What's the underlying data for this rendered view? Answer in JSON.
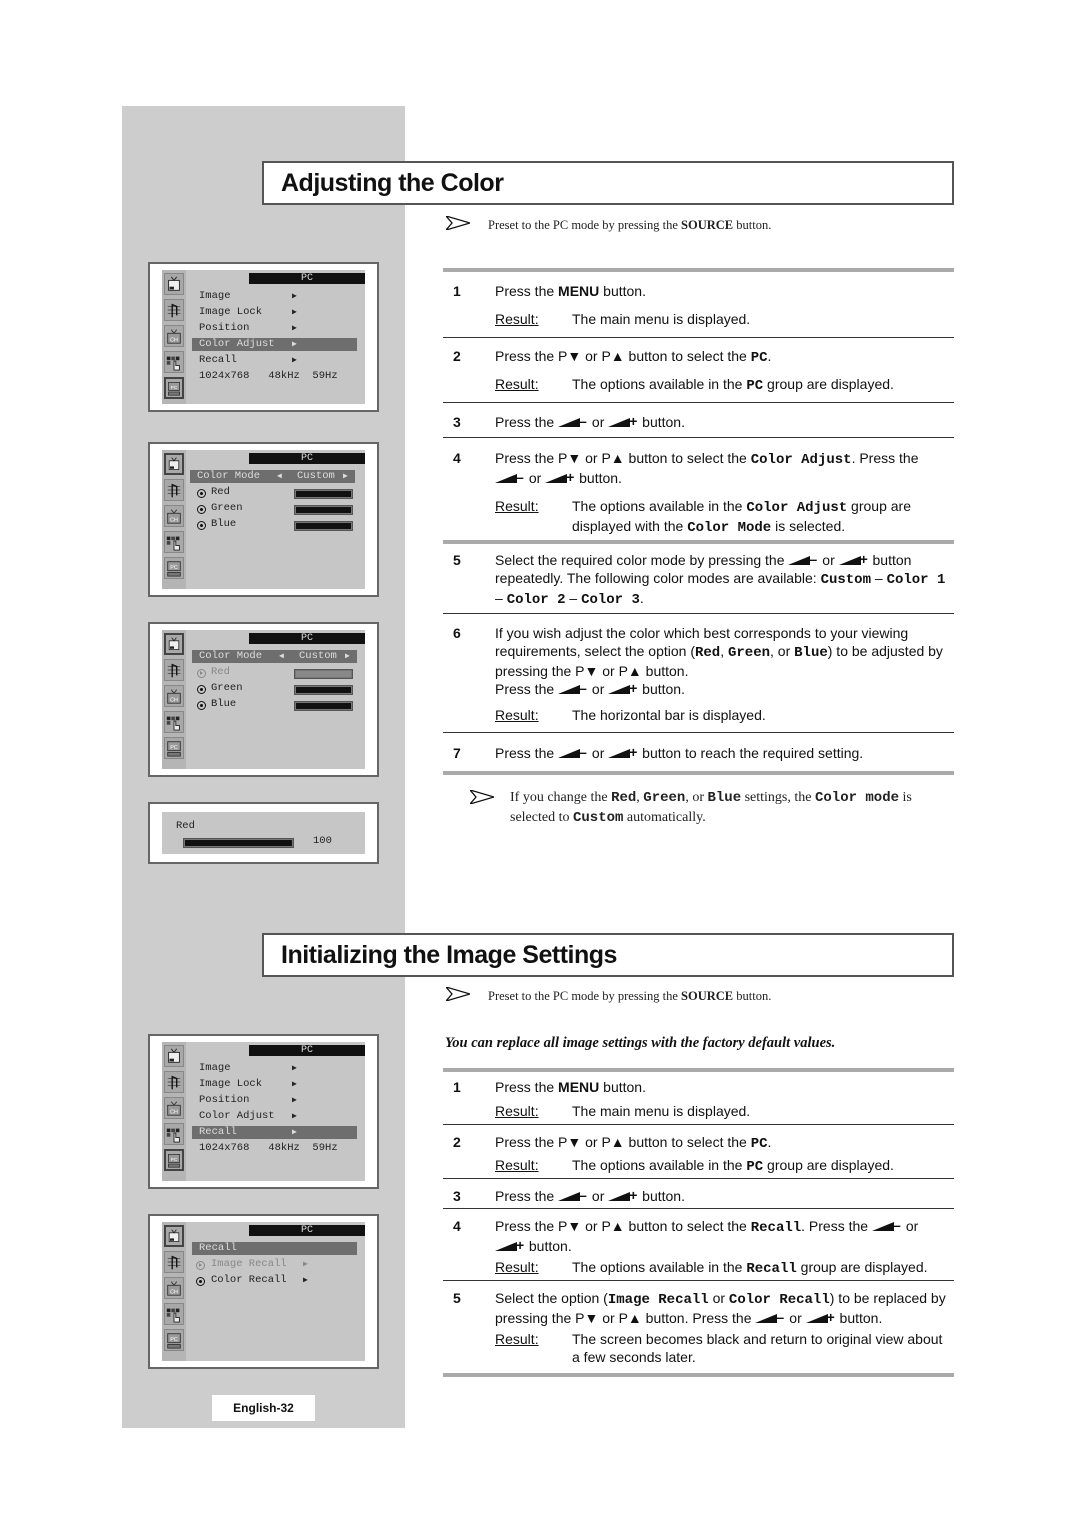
{
  "page": {
    "number_label": "English-32"
  },
  "section1": {
    "title": "Adjusting the Color",
    "note": {
      "prefix": "Preset to the PC mode by pressing the ",
      "bold": "SOURCE",
      "suffix": " button."
    },
    "steps": [
      {
        "num": "1",
        "text": "Press the <b>MENU</b> button.",
        "result_label": "Result",
        "result": "The main menu is displayed."
      },
      {
        "num": "2",
        "text": "Press the P▼ or P▲ button to select the <span class='mono'>PC</span>.",
        "result_label": "Result",
        "result": "The options available in the <span class='mono'>PC</span> group are displayed."
      },
      {
        "num": "3",
        "text": "Press the {vol-} or {vol+} button."
      },
      {
        "num": "4",
        "text": "Press the P▼ or P▲ button to select the <span class='mono'>Color Adjust</span>. Press the {vol-} or {vol+} button.",
        "result_label": "Result",
        "result": "The options available in the <span class='mono'>Color Adjust</span> group are displayed with the <span class='mono'>Color Mode</span> is selected."
      },
      {
        "num": "5",
        "text": "Select the required color mode by pressing the {vol-} or {vol+} button repeatedly. The following color modes are available: <span class='mono'>Custom</span> – <span class='mono'>Color 1</span> – <span class='mono'>Color 2</span> – <span class='mono'>Color 3</span>."
      },
      {
        "num": "6",
        "text": "If you wish adjust the color which best corresponds to your viewing requirements, select the option (<span class='mono'>Red</span>, <span class='mono'>Green</span>, or <span class='mono'>Blue</span>) to be adjusted by pressing the P▼ or P▲ button.<br>Press the {vol-} or {vol+} button.",
        "result_label": "Result",
        "result": "The horizontal bar is displayed."
      },
      {
        "num": "7",
        "text": "Press the {vol-} or {vol+} button to reach the required setting."
      }
    ],
    "footnote": "If you change the <span class='mono'>Red</span>, <span class='mono'>Green</span>, or <span class='mono'>Blue</span> settings, the <span class='mono'>Color mode</span> is selected to <span class='mono'>Custom</span> automatically."
  },
  "section2": {
    "title": "Initializing the Image Settings",
    "note": {
      "prefix": "Preset to the PC mode by pressing the ",
      "bold": "SOURCE",
      "suffix": " button."
    },
    "subhead": "You can replace all image settings with the factory default values.",
    "steps": [
      {
        "num": "1",
        "text": "Press the <b>MENU</b> button.",
        "result_label": "Result",
        "result": "The main menu is displayed."
      },
      {
        "num": "2",
        "text": "Press the P▼ or P▲ button to select the <span class='mono'>PC</span>.",
        "result_label": "Result",
        "result": "The options available in the <span class='mono'>PC</span> group are displayed."
      },
      {
        "num": "3",
        "text": "Press the {vol-} or {vol+} button."
      },
      {
        "num": "4",
        "text": "Press the P▼ or P▲ button to select the <span class='mono'>Recall</span>. Press the {vol-} or {vol+} button.",
        "result_label": "Result",
        "result": "The options available in the <span class='mono'>Recall</span> group are displayed."
      },
      {
        "num": "5",
        "text": "Select the option (<span class='mono'>Image Recall</span> or <span class='mono'>Color Recall</span>) to be replaced by pressing the P▼ or P▲ button. Press the {vol-} or {vol+} button.",
        "result_label": "Result",
        "result": "The screen becomes black and return to original view about a few seconds later."
      }
    ]
  },
  "osd": {
    "header": "PC",
    "menu1": {
      "items": [
        "Image",
        "Image Lock",
        "Position",
        "Color Adjust",
        "Recall"
      ],
      "selected": "Color Adjust",
      "info": [
        "1024x768",
        "48kHz",
        "59Hz"
      ]
    },
    "color_adjust": {
      "mode_label": "Color Mode",
      "mode_value": "Custom",
      "channels": [
        "Red",
        "Green",
        "Blue"
      ]
    },
    "red_bar": {
      "label": "Red",
      "value": "100"
    },
    "menu2": {
      "items": [
        "Image",
        "Image Lock",
        "Position",
        "Color Adjust",
        "Recall"
      ],
      "selected": "Recall",
      "info": [
        "1024x768",
        "48kHz",
        "59Hz"
      ]
    },
    "recall": {
      "title": "Recall",
      "items": [
        "Image Recall",
        "Color Recall"
      ]
    },
    "icons": [
      "picture-icon",
      "sound-icon",
      "channel-icon",
      "setup-icon",
      "pc-icon"
    ]
  }
}
